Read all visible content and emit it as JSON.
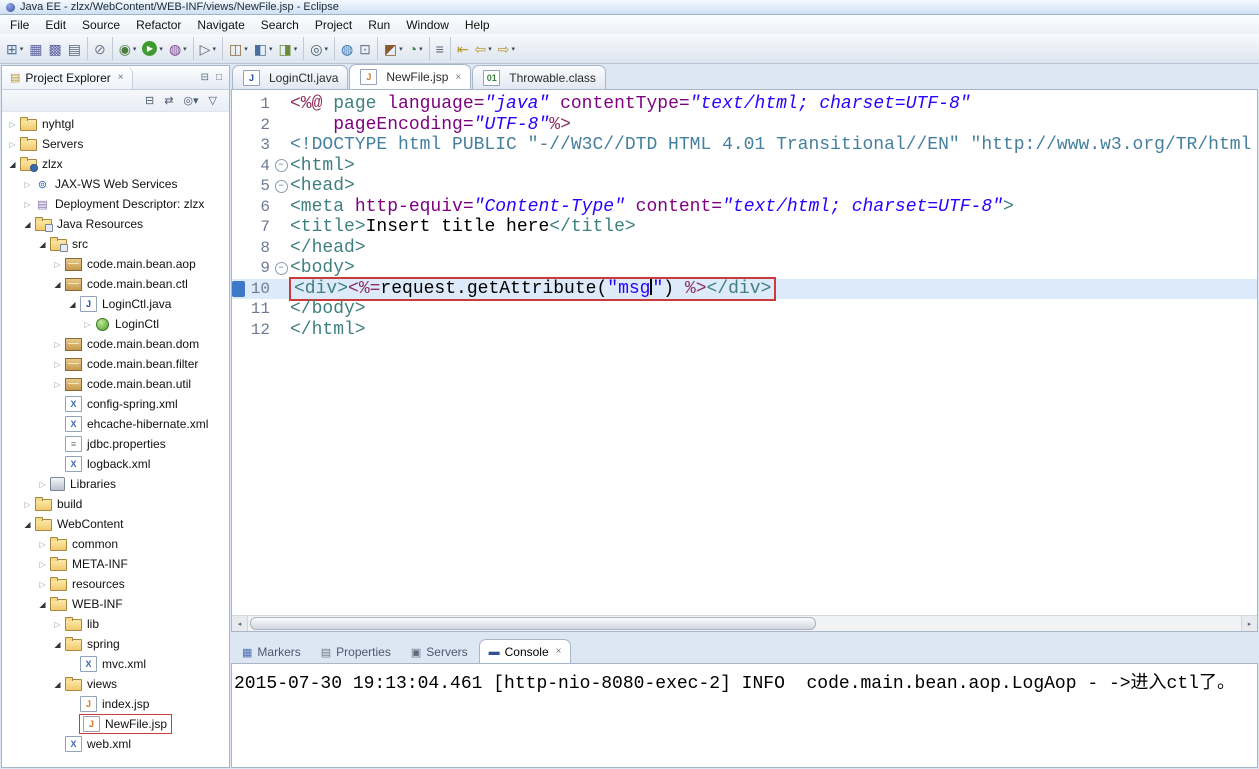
{
  "window": {
    "title": "Java EE - zlzx/WebContent/WEB-INF/views/NewFile.jsp - Eclipse"
  },
  "menubar": {
    "items": [
      "File",
      "Edit",
      "Source",
      "Refactor",
      "Navigate",
      "Search",
      "Project",
      "Run",
      "Window",
      "Help"
    ]
  },
  "toolbar": {
    "buttons": [
      {
        "name": "new-wizard",
        "glyph": "⊞",
        "color": "#4a6d9b",
        "dd": true
      },
      {
        "name": "save",
        "glyph": "▦",
        "color": "#5c5f9e"
      },
      {
        "name": "save-all",
        "glyph": "▩",
        "color": "#5c5f9e"
      },
      {
        "name": "print",
        "glyph": "▤",
        "color": "#5a6678",
        "sep": true
      },
      {
        "name": "build-all",
        "glyph": "⊘",
        "color": "#6a7688",
        "sep": true
      },
      {
        "name": "debug",
        "glyph": "◉",
        "color": "#4a7f3f",
        "dd": true
      },
      {
        "name": "run",
        "glyph": "▶",
        "bg": "#3f9b2f",
        "color": "#ffffff",
        "dd": true
      },
      {
        "name": "coverage",
        "glyph": "◍",
        "color": "#7a3f8f",
        "dd": true,
        "sep": true
      },
      {
        "name": "run-external-tools",
        "glyph": "▷",
        "color": "#555f6e",
        "dd": true,
        "sep": true
      },
      {
        "name": "new-servlet",
        "glyph": "◫",
        "color": "#8a6d3b",
        "dd": true
      },
      {
        "name": "new-dynamic-web-project",
        "glyph": "◧",
        "color": "#4a6d9b",
        "dd": true
      },
      {
        "name": "new-ejb-project",
        "glyph": "◨",
        "color": "#6d8a3b",
        "dd": true,
        "sep": true
      },
      {
        "name": "search",
        "glyph": "◎",
        "color": "#4a5a6a",
        "dd": true,
        "sep": true
      },
      {
        "name": "open-web-browser",
        "glyph": "◍",
        "color": "#2a6db0"
      },
      {
        "name": "open-task",
        "glyph": "⊡",
        "color": "#6a7a8a",
        "sep": true
      },
      {
        "name": "new-java-project",
        "glyph": "◩",
        "color": "#8a5a2a",
        "dd": true
      },
      {
        "name": "new-class",
        "glyph": "◔",
        "color": "#3f7f3f",
        "dd": true,
        "sep": true
      },
      {
        "name": "mark-occurrences",
        "glyph": "≡",
        "color": "#5a6a7a",
        "sep": true
      },
      {
        "name": "last-edit-location",
        "glyph": "⇤",
        "color": "#b8962e"
      },
      {
        "name": "back",
        "glyph": "⇦",
        "color": "#b8962e",
        "dd": true
      },
      {
        "name": "forward",
        "glyph": "⇨",
        "color": "#b8962e",
        "dd": true
      }
    ]
  },
  "explorer": {
    "title": "Project Explorer",
    "close_glyph": "×",
    "controls": [
      {
        "name": "minimize-view",
        "glyph": "⊟"
      },
      {
        "name": "maximize-view",
        "glyph": "□"
      }
    ],
    "toolbar": [
      {
        "name": "collapse-all",
        "glyph": "⊟"
      },
      {
        "name": "link-with-editor",
        "glyph": "⇄"
      },
      {
        "name": "focus-on-active-task",
        "glyph": "◎",
        "dd": true
      },
      {
        "name": "view-menu",
        "glyph": "▽"
      }
    ],
    "tree": [
      {
        "label": "nyhtgl",
        "icon": "folder",
        "level": 0,
        "state": "collapsed"
      },
      {
        "label": "Servers",
        "icon": "folder",
        "level": 0,
        "state": "collapsed"
      },
      {
        "label": "zlzx",
        "icon": "project",
        "level": 0,
        "state": "expanded"
      },
      {
        "label": "JAX-WS Web Services",
        "icon": "web-service",
        "level": 1,
        "state": "collapsed"
      },
      {
        "label": "Deployment Descriptor: zlzx",
        "icon": "descriptor",
        "level": 1,
        "state": "collapsed"
      },
      {
        "label": "Java Resources",
        "icon": "java-resources",
        "level": 1,
        "state": "expanded"
      },
      {
        "label": "src",
        "icon": "source-folder",
        "level": 2,
        "state": "expanded"
      },
      {
        "label": "code.main.bean.aop",
        "icon": "package",
        "level": 3,
        "state": "collapsed"
      },
      {
        "label": "code.main.bean.ctl",
        "icon": "package",
        "level": 3,
        "state": "expanded"
      },
      {
        "label": "LoginCtl.java",
        "icon": "java-file",
        "level": 4,
        "state": "expanded"
      },
      {
        "label": "LoginCtl",
        "icon": "class",
        "level": 5,
        "state": "collapsed"
      },
      {
        "label": "code.main.bean.dom",
        "icon": "package",
        "level": 3,
        "state": "collapsed"
      },
      {
        "label": "code.main.bean.filter",
        "icon": "package",
        "level": 3,
        "state": "collapsed"
      },
      {
        "label": "code.main.bean.util",
        "icon": "package",
        "level": 3,
        "state": "collapsed"
      },
      {
        "label": "config-spring.xml",
        "icon": "xml-file",
        "level": 3
      },
      {
        "label": "ehcache-hibernate.xml",
        "icon": "xml-file",
        "level": 3
      },
      {
        "label": "jdbc.properties",
        "icon": "properties-file",
        "level": 3
      },
      {
        "label": "logback.xml",
        "icon": "xml-file",
        "level": 3
      },
      {
        "label": "Libraries",
        "icon": "library",
        "level": 2,
        "state": "collapsed"
      },
      {
        "label": "build",
        "icon": "folder",
        "level": 1,
        "state": "collapsed"
      },
      {
        "label": "WebContent",
        "icon": "folder",
        "level": 1,
        "state": "expanded"
      },
      {
        "label": "common",
        "icon": "folder",
        "level": 2,
        "state": "collapsed"
      },
      {
        "label": "META-INF",
        "icon": "folder",
        "level": 2,
        "state": "collapsed"
      },
      {
        "label": "resources",
        "icon": "folder",
        "level": 2,
        "state": "collapsed"
      },
      {
        "label": "WEB-INF",
        "icon": "folder",
        "level": 2,
        "state": "expanded"
      },
      {
        "label": "lib",
        "icon": "folder",
        "level": 3,
        "state": "collapsed"
      },
      {
        "label": "spring",
        "icon": "folder",
        "level": 3,
        "state": "expanded"
      },
      {
        "label": "mvc.xml",
        "icon": "xml-file",
        "level": 4
      },
      {
        "label": "views",
        "icon": "folder",
        "level": 3,
        "state": "expanded"
      },
      {
        "label": "index.jsp",
        "icon": "jsp-file",
        "level": 4
      },
      {
        "label": "NewFile.jsp",
        "icon": "jsp-file",
        "level": 4,
        "boxed": true
      },
      {
        "label": "web.xml",
        "icon": "xml-file",
        "level": 3
      }
    ]
  },
  "editor": {
    "tabs": [
      {
        "label": "LoginCtl.java",
        "icon": "java-file",
        "active": false,
        "closable": false
      },
      {
        "label": "NewFile.jsp",
        "icon": "jsp-file",
        "active": true,
        "closable": true,
        "close_glyph": "×"
      },
      {
        "label": "Throwable.class",
        "icon": "class-binary",
        "active": false,
        "closable": false
      }
    ],
    "lines": [
      {
        "num": 1,
        "segments": [
          {
            "t": "<%@ ",
            "c": "jsp"
          },
          {
            "t": "page ",
            "c": "tag"
          },
          {
            "t": "language=",
            "c": "attr"
          },
          {
            "t": "\"java\"",
            "c": "str"
          },
          {
            "t": " contentType=",
            "c": "attr"
          },
          {
            "t": "\"text/html; charset=UTF-8\"",
            "c": "str"
          }
        ]
      },
      {
        "num": 2,
        "segments": [
          {
            "t": "    pageEncoding=",
            "c": "attr"
          },
          {
            "t": "\"UTF-8\"",
            "c": "str"
          },
          {
            "t": "%>",
            "c": "jsp"
          }
        ]
      },
      {
        "num": 3,
        "segments": [
          {
            "t": "<!DOCTYPE html PUBLIC \"-//W3C//DTD HTML 4.01 Transitional//EN\" \"http://www.w3.org/TR/html",
            "c": "doctype"
          }
        ]
      },
      {
        "num": 4,
        "fold": true,
        "segments": [
          {
            "t": "<html>",
            "c": "tag"
          }
        ]
      },
      {
        "num": 5,
        "fold": true,
        "segments": [
          {
            "t": "<head>",
            "c": "tag"
          }
        ]
      },
      {
        "num": 6,
        "segments": [
          {
            "t": "<meta ",
            "c": "tag"
          },
          {
            "t": "http-equiv=",
            "c": "attr"
          },
          {
            "t": "\"Content-Type\"",
            "c": "str"
          },
          {
            "t": " content=",
            "c": "attr"
          },
          {
            "t": "\"text/html; charset=UTF-8\"",
            "c": "str"
          },
          {
            "t": ">",
            "c": "tag"
          }
        ]
      },
      {
        "num": 7,
        "segments": [
          {
            "t": "<title>",
            "c": "tag"
          },
          {
            "t": "Insert title here",
            "c": "plain"
          },
          {
            "t": "</title>",
            "c": "tag"
          }
        ]
      },
      {
        "num": 8,
        "segments": [
          {
            "t": "</head>",
            "c": "tag"
          }
        ]
      },
      {
        "num": 9,
        "fold": true,
        "segments": [
          {
            "t": "<body>",
            "c": "tag"
          }
        ]
      },
      {
        "num": 10,
        "current": true,
        "boxed": true,
        "segments": [
          {
            "t": "<div>",
            "c": "tag"
          },
          {
            "t": "<%=",
            "c": "jsp"
          },
          {
            "t": "request.getAttribute(",
            "c": "plain"
          },
          {
            "t": "\"msg",
            "c": "str2"
          },
          {
            "t": "",
            "c": "cursor"
          },
          {
            "t": "\"",
            "c": "str2"
          },
          {
            "t": ") ",
            "c": "plain"
          },
          {
            "t": "%>",
            "c": "jsp"
          },
          {
            "t": "</div>",
            "c": "tag"
          }
        ]
      },
      {
        "num": 11,
        "segments": [
          {
            "t": "</body>",
            "c": "tag"
          }
        ]
      },
      {
        "num": 12,
        "segments": [
          {
            "t": "</html>",
            "c": "tag"
          }
        ]
      }
    ]
  },
  "bottom": {
    "tabs": [
      {
        "label": "Markers",
        "icon": "markers"
      },
      {
        "label": "Properties",
        "icon": "properties"
      },
      {
        "label": "Servers",
        "icon": "servers"
      },
      {
        "label": "Console",
        "icon": "console",
        "active": true,
        "closable": true,
        "close_glyph": "×"
      }
    ],
    "console_line": "2015-07-30 19:13:04.461 [http-nio-8080-exec-2] INFO  code.main.bean.aop.LogAop - ->进入ctl了。"
  }
}
